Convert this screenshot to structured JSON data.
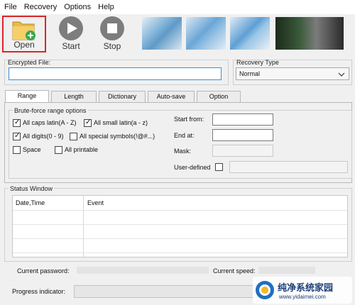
{
  "menu": [
    "File",
    "Recovery",
    "Options",
    "Help"
  ],
  "toolbar": {
    "open": "Open",
    "start": "Start",
    "stop": "Stop"
  },
  "encrypted_file": {
    "label": "Encrypted File:",
    "value": ""
  },
  "recovery_type": {
    "label": "Recovery Type",
    "value": "Normal"
  },
  "tabs": [
    "Range",
    "Length",
    "Dictionary",
    "Auto-save",
    "Option"
  ],
  "range": {
    "group_title": "Brute-force range options",
    "options": [
      {
        "label": "All caps latin(A - Z)",
        "checked": true
      },
      {
        "label": "All small latin(a - z)",
        "checked": true
      },
      {
        "label": "All digits(0 - 9)",
        "checked": true
      },
      {
        "label": "All special symbols(!@#...)",
        "checked": false
      },
      {
        "label": "Space",
        "checked": false
      },
      {
        "label": "All printable",
        "checked": false
      }
    ],
    "start_from": "Start from:",
    "end_at": "End at:",
    "mask": "Mask:",
    "user_defined": "User-defined"
  },
  "status": {
    "title": "Status Window",
    "columns": [
      "Date,Time",
      "Event"
    ]
  },
  "bottom": {
    "current_password": "Current password:",
    "current_speed": "Current speed:",
    "progress_indicator": "Progress indicator:",
    "progress": 0
  },
  "watermark": {
    "site": "纯净系统家园",
    "url": "www.yidaimei.com"
  },
  "colors": {
    "highlight_border": "#d9262a",
    "field_focus": "#3c8fd6",
    "background": "#f0f0f0"
  }
}
